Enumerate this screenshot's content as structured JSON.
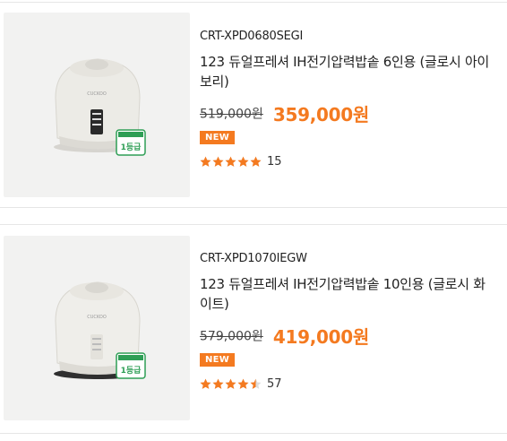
{
  "products": [
    {
      "model": "CRT-XPD0680SEGI",
      "name": "123 듀얼프레셔 IH전기압력밥솥 6인용 (글로시 아이보리)",
      "old_price": "519,000원",
      "new_price": "359,000원",
      "badge": "NEW",
      "rating": 5,
      "review_count": "15",
      "image_label": "CUCKOO",
      "grade_badge": "1등급"
    },
    {
      "model": "CRT-XPD1070IEGW",
      "name": "123 듀얼프레셔 IH전기압력밥솥 10인용 (글로시 화이트)",
      "old_price": "579,000원",
      "new_price": "419,000원",
      "badge": "NEW",
      "rating": 4.5,
      "review_count": "57",
      "image_label": "CUCKOO",
      "grade_badge": "1등급"
    }
  ],
  "colors": {
    "accent": "#f47a20",
    "star": "#f47a20",
    "divider": "#e6e6e6"
  }
}
